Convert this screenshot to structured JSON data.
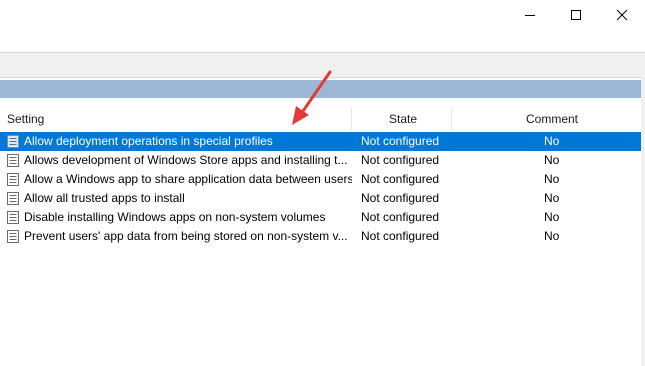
{
  "window": {
    "minimize_icon": "minimize-icon",
    "maximize_icon": "maximize-icon",
    "close_icon": "close-icon"
  },
  "table": {
    "columns": {
      "setting": "Setting",
      "state": "State",
      "comment": "Comment"
    },
    "rows": [
      {
        "setting": "Allow deployment operations in special profiles",
        "state": "Not configured",
        "comment": "No",
        "selected": true
      },
      {
        "setting": "Allows development of Windows Store apps and installing t...",
        "state": "Not configured",
        "comment": "No"
      },
      {
        "setting": "Allow a Windows app to share application data between users",
        "state": "Not configured",
        "comment": "No"
      },
      {
        "setting": "Allow all trusted apps to install",
        "state": "Not configured",
        "comment": "No"
      },
      {
        "setting": "Disable installing Windows apps on non-system volumes",
        "state": "Not configured",
        "comment": "No"
      },
      {
        "setting": "Prevent users' app data from being stored on non-system v...",
        "state": "Not configured",
        "comment": "No"
      }
    ]
  },
  "colors": {
    "selection": "#0078d7",
    "band": "#9bb7d4",
    "arrow": "#e53935"
  }
}
